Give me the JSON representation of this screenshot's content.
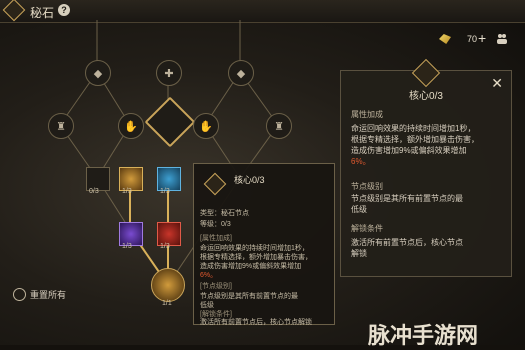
{
  "header": {
    "title": "秘石",
    "help": "?"
  },
  "resource": {
    "value": "70",
    "plus": "+"
  },
  "tree": {
    "counts": [
      "0/3",
      "1/3",
      "1/3",
      "1/3",
      "1/3",
      "1/1"
    ]
  },
  "reset_label": "重置所有",
  "panel": {
    "title": "核心0/3",
    "sections": [
      {
        "label": "属性加成",
        "lines": [
          "命运回响效果的持续时间增加1秒，",
          "根据专精选择，额外增加暴击伤害，",
          "造成伤害增加9%或偏斜效果增加",
          "6%。"
        ]
      },
      {
        "label": "节点级别",
        "lines": [
          "节点级别是其所有前置节点的最",
          "低级"
        ]
      },
      {
        "label": "解锁条件",
        "lines": [
          "激活所有前置节点后，核心节点",
          "解锁"
        ]
      }
    ],
    "close": "✕"
  },
  "tooltip": {
    "title": "核心0/3",
    "type_line": "类型：秘石节点",
    "grade_line": "等级：0/3",
    "sec1": "[属性加成]",
    "lines1": [
      "命运回响效果的持续时间增加1秒，",
      "根据专精选择，额外增加暴击伤害，",
      "造成伤害增加9%或偏斜效果增加",
      "6%。"
    ],
    "sec2": "[节点级别]",
    "lines2": [
      "节点级别是其所有前置节点的最",
      "低级"
    ],
    "sec3": "[解锁条件]",
    "lines3": [
      "激活所有前置节点后，核心节点解锁"
    ]
  },
  "watermark": "脉冲手游网"
}
